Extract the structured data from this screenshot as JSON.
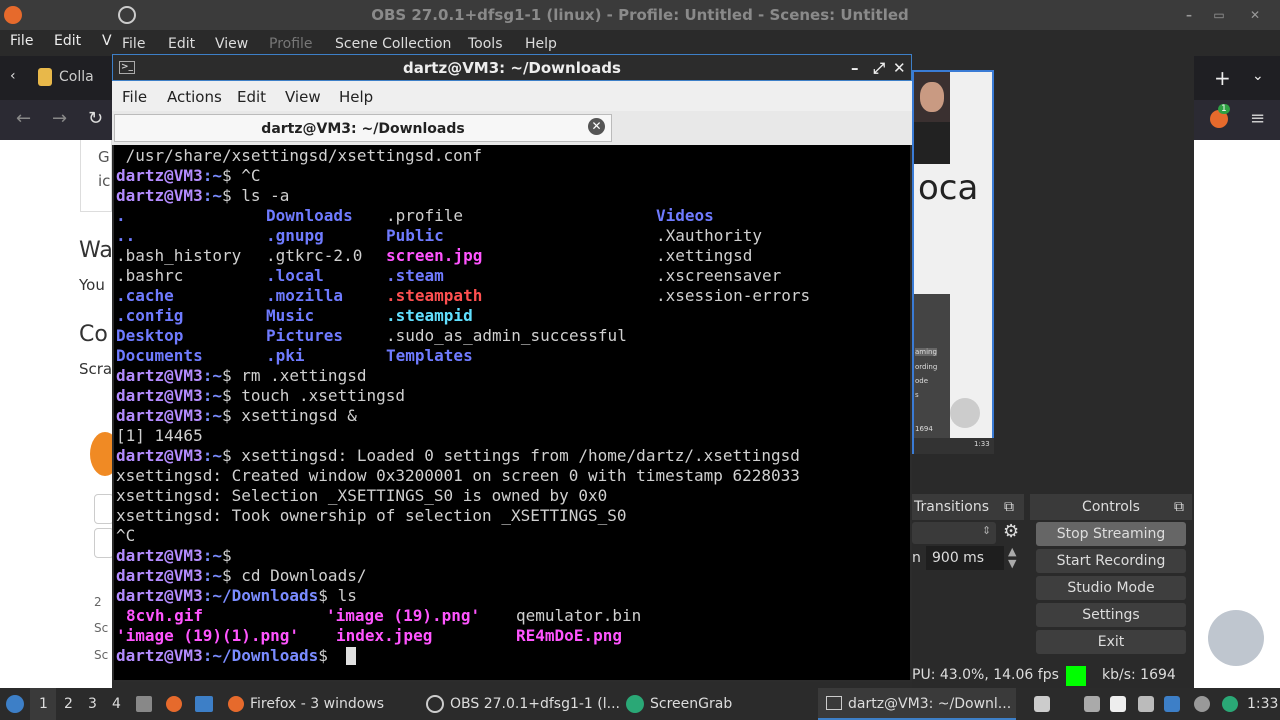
{
  "obs": {
    "window_title": "OBS 27.0.1+dfsg1-1 (linux) - Profile: Untitled - Scenes: Untitled",
    "menu": [
      "File",
      "Edit",
      "View",
      "Profile",
      "Scene Collection",
      "Tools",
      "Help"
    ],
    "docks": {
      "transitions": "Transitions",
      "controls": "Controls"
    },
    "duration_value": "900 ms",
    "duration_prefix": "n",
    "controls": [
      "Stop Streaming",
      "Start Recording",
      "Studio Mode",
      "Settings",
      "Exit"
    ],
    "status": {
      "cpu": "PU: 43.0%, 14.06 fps",
      "kbs": "kb/s: 1694"
    },
    "preview_text": "oca",
    "preview_menu": [
      "aming",
      "ording",
      "ode",
      "s"
    ],
    "preview_bar_text": "1694",
    "preview_clock": "1:33"
  },
  "browser": {
    "menu": [
      "File",
      "Edit",
      "V"
    ],
    "tab_label": "Colla",
    "page_text": [
      "G",
      "ic",
      "Wa",
      "You",
      "Co",
      "Scra",
      "2",
      "Sc",
      "Sc"
    ]
  },
  "terminal": {
    "title": "dartz@VM3: ~/Downloads",
    "menu": [
      "File",
      "Actions",
      "Edit",
      "View",
      "Help"
    ],
    "tab_label": "dartz@VM3: ~/Downloads",
    "prompt_host": "dartz@VM3",
    "lines": [
      {
        "text": " /usr/share/xsettingsd/xsettingsd.conf"
      },
      {
        "path": ":~",
        "cmd": "$ ^C"
      },
      {
        "path": ":~",
        "cmd": "$ ls -a"
      },
      {
        "path": ":~",
        "cmd": "$ rm .xettingsd"
      },
      {
        "path": ":~",
        "cmd": "$ touch .xsettingsd"
      },
      {
        "path": ":~",
        "cmd": "$ xsettingsd &"
      },
      {
        "text": "[1] 14465"
      },
      {
        "path": ":~",
        "cmd": "$ xsettingsd: Loaded 0 settings from /home/dartz/.xsettingsd"
      },
      {
        "text": "xsettingsd: Created window 0x3200001 on screen 0 with timestamp 6228033"
      },
      {
        "text": "xsettingsd: Selection _XSETTINGS_S0 is owned by 0x0"
      },
      {
        "text": "xsettingsd: Took ownership of selection _XSETTINGS_S0"
      },
      {
        "text": "^C"
      },
      {
        "path": ":~",
        "cmd": "$"
      },
      {
        "path": ":~",
        "cmd": "$ cd Downloads/"
      },
      {
        "path": ":~/Downloads",
        "cmd": "$ ls"
      },
      {
        "path": ":~/Downloads",
        "cmd": "$ "
      }
    ],
    "ls_a": [
      [
        ".",
        "Downloads",
        ".profile",
        "Videos"
      ],
      [
        "..",
        ".gnupg",
        "Public",
        ".Xauthority"
      ],
      [
        ".bash_history",
        ".gtkrc-2.0",
        "screen.jpg",
        ".xettingsd"
      ],
      [
        ".bashrc",
        ".local",
        ".steam",
        ".xscreensaver"
      ],
      [
        ".cache",
        ".mozilla",
        ".steampath",
        ".xsession-errors"
      ],
      [
        ".config",
        "Music",
        ".steampid",
        ""
      ],
      [
        "Desktop",
        "Pictures",
        ".sudo_as_admin_successful",
        ""
      ],
      [
        "Documents",
        ".pki",
        "Templates",
        ""
      ]
    ],
    "ls_downloads": [
      [
        "8cvh.gif",
        "'image (19).png'",
        "qemulator.bin"
      ],
      [
        "'image (19)(1).png'",
        "index.jpeg",
        "RE4mDoE.png"
      ]
    ]
  },
  "taskbar": {
    "workspaces": [
      "1",
      "2",
      "3",
      "4"
    ],
    "tasks": [
      "Firefox - 3 windows",
      "OBS 27.0.1+dfsg1-1 (l...",
      "ScreenGrab",
      "dartz@VM3: ~/Downl..."
    ],
    "clock": "1:33",
    "badge": "1"
  },
  "colors": {
    "accent": "#3d7fc7",
    "prompt": "#b48cff",
    "dir": "#6f7bff",
    "image": "#ff55ff",
    "status_green": "#00ff00"
  }
}
